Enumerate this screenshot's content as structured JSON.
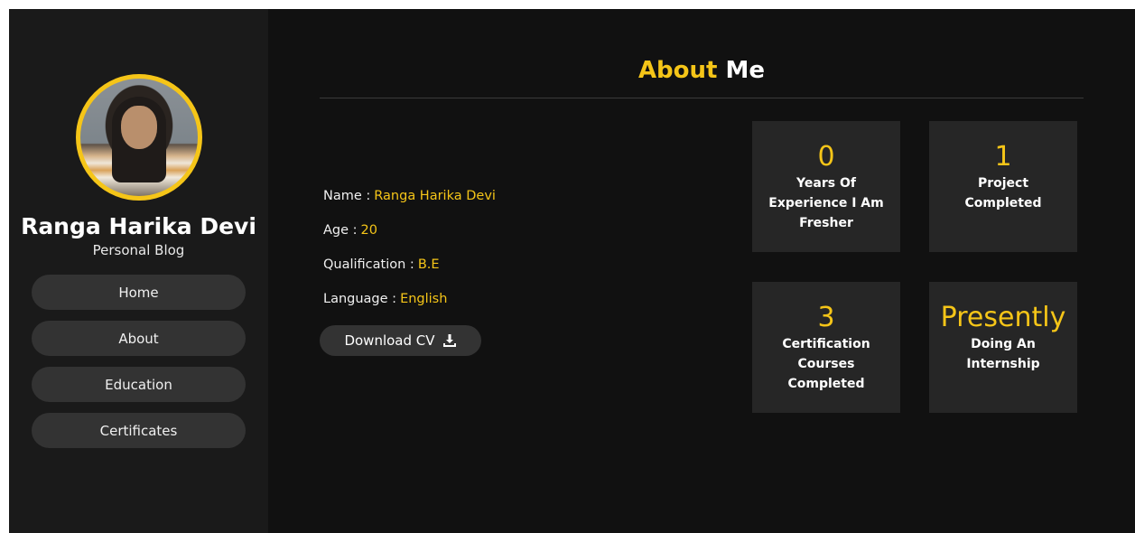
{
  "profile": {
    "name": "Ranga Harika Devi",
    "subtitle": "Personal Blog"
  },
  "nav": {
    "items": [
      {
        "label": "Home"
      },
      {
        "label": "About"
      },
      {
        "label": "Education"
      },
      {
        "label": "Certificates"
      }
    ]
  },
  "about": {
    "title_accent": "About",
    "title_rest": "Me",
    "info": [
      {
        "label": "Name :",
        "value": "Ranga Harika Devi"
      },
      {
        "label": "Age :",
        "value": "20"
      },
      {
        "label": "Qualification :",
        "value": "B.E"
      },
      {
        "label": "Language :",
        "value": "English"
      }
    ],
    "download_label": "Download CV",
    "download_icon": "download-icon"
  },
  "stats": [
    {
      "number": "0",
      "label": "Years Of Experience I Am Fresher"
    },
    {
      "number": "1",
      "label": "Project Completed"
    },
    {
      "number": "3",
      "label": "Certification Courses Completed"
    },
    {
      "number": "Presently",
      "label": "Doing An Internship"
    }
  ],
  "colors": {
    "accent": "#f5c518",
    "background": "#111111",
    "sidebar": "#1a1a1a",
    "button": "#333333",
    "card": "#262626"
  }
}
